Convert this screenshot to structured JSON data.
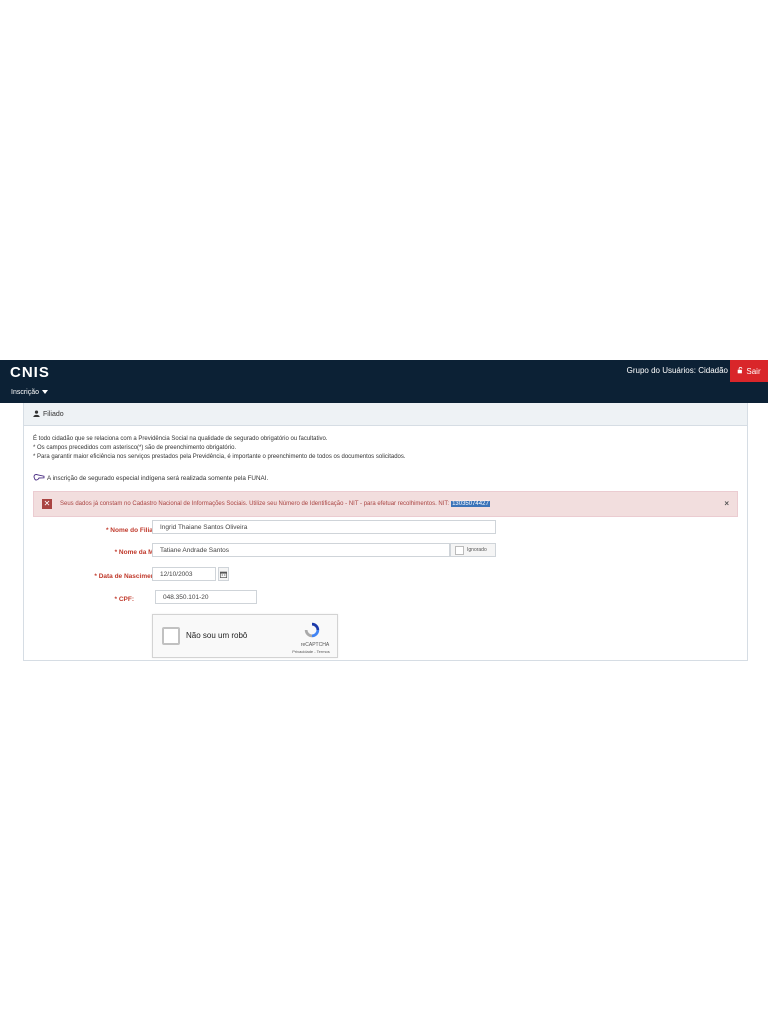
{
  "header": {
    "logo": "CNIS",
    "user_group": "Grupo do Usuários: Cidadão",
    "logout_label": "Sair",
    "menu_label": "Inscrição"
  },
  "panel": {
    "title": "Filiado",
    "intro": [
      "É todo cidadão que se relaciona com a Previdência Social na qualidade de segurado obrigatório ou facultativo.",
      "* Os campos precedidos com asterisco(*) são de preenchimento obrigatório.",
      "* Para garantir maior eficiência nos serviços prestados pela Previdência, é importante o preenchimento de todos os documentos solicitados."
    ],
    "notice": "A inscrição de segurado especial indígena será realizada somente pela FUNAI."
  },
  "alert": {
    "message": "Seus dados já constam no Cadastro Nacional de Informações Sociais. Utilize seu Número de Identificação - NIT - para efetuar recolhimentos. NIT:",
    "nit": "13035074427"
  },
  "form": {
    "nome_filiado_label": "* Nome do Filiado:",
    "nome_filiado_value": "Ingrid Thaiane Santos Oliveira",
    "nome_mae_label": "* Nome da Mãe:",
    "nome_mae_value": "Tatiane Andrade Santos",
    "ignorado_label": "Ignorado",
    "data_nasc_label": "* Data de Nascimento:",
    "data_nasc_value": "12/10/2003",
    "cpf_label": "* CPF:",
    "cpf_value": "048.350.101-20"
  },
  "captcha": {
    "label": "Não sou um robô",
    "brand": "reCAPTCHA",
    "links": "Privacidade - Termos"
  },
  "colors": {
    "header_bg": "#0c2135",
    "logout_bg": "#d9262a",
    "alert_bg": "#f2dede",
    "alert_text": "#a94442",
    "required_label": "#c0392b",
    "nit_highlight": "#3b73b9"
  }
}
